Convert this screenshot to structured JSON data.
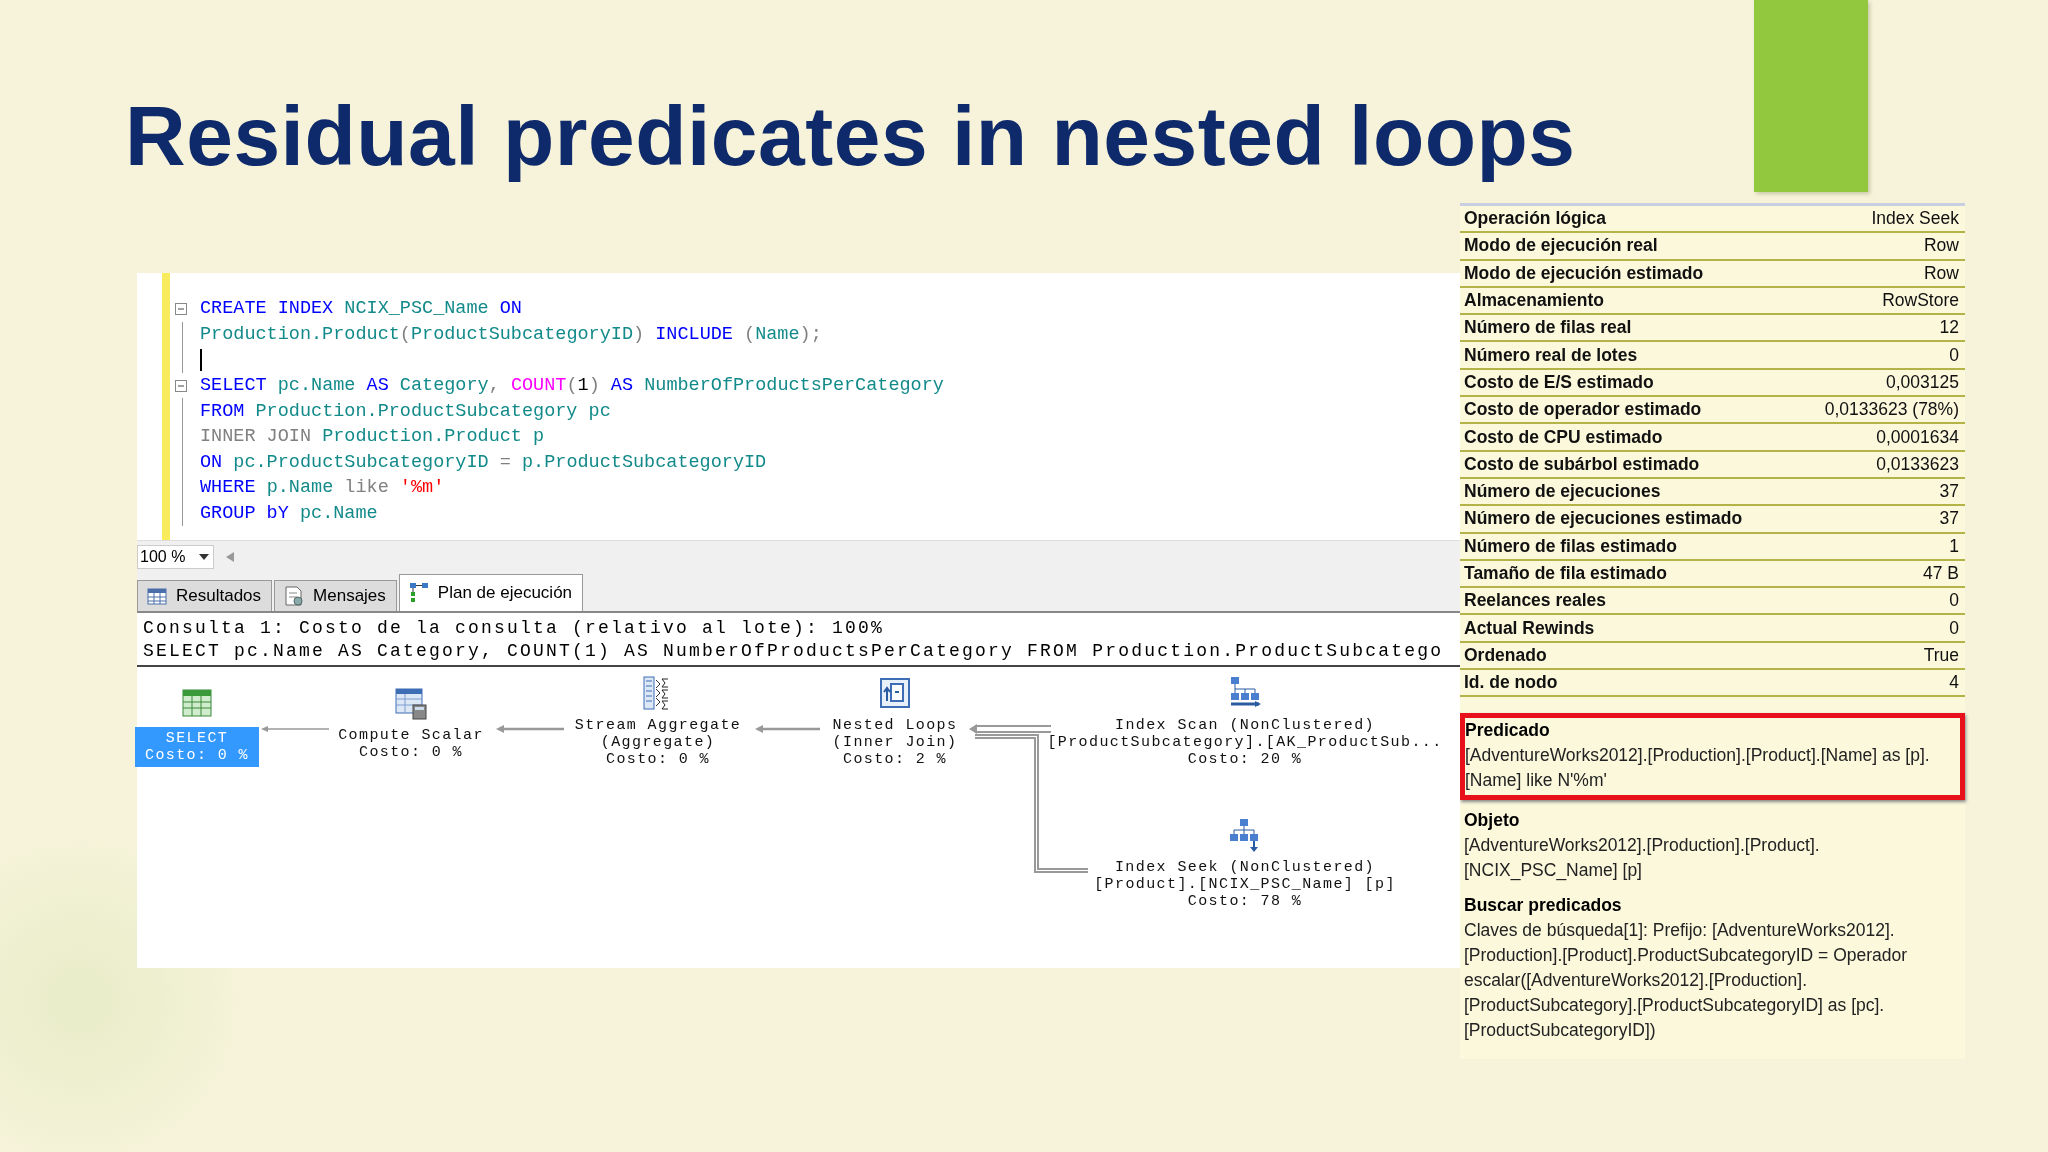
{
  "slide": {
    "title": "Residual predicates in nested loops"
  },
  "editor": {
    "lines": [
      {
        "fold": true,
        "tokens": [
          {
            "text": "CREATE INDEX ",
            "kind": "kw"
          },
          {
            "text": "NCIX_PSC_Name ",
            "kind": "id"
          },
          {
            "text": "ON",
            "kind": "kw"
          }
        ]
      },
      {
        "fold": false,
        "tokens": [
          {
            "text": "Production.Product",
            "kind": "id"
          },
          {
            "text": "(",
            "kind": "op"
          },
          {
            "text": "ProductSubcategoryID",
            "kind": "id"
          },
          {
            "text": ") ",
            "kind": "op"
          },
          {
            "text": "INCLUDE ",
            "kind": "kw"
          },
          {
            "text": "(",
            "kind": "op"
          },
          {
            "text": "Name",
            "kind": "id"
          },
          {
            "text": ");",
            "kind": "op"
          }
        ]
      },
      {
        "fold": false,
        "cursor": true
      },
      {
        "fold": true,
        "tokens": [
          {
            "text": "SELECT ",
            "kind": "kw"
          },
          {
            "text": "pc.Name ",
            "kind": "id"
          },
          {
            "text": "AS ",
            "kind": "kw"
          },
          {
            "text": "Category",
            "kind": "id"
          },
          {
            "text": ", ",
            "kind": "op"
          },
          {
            "text": "COUNT",
            "kind": "fn"
          },
          {
            "text": "(",
            "kind": "op"
          },
          {
            "text": "1",
            "kind": "num"
          },
          {
            "text": ") ",
            "kind": "op"
          },
          {
            "text": "AS ",
            "kind": "kw"
          },
          {
            "text": "NumberOfProductsPerCategory",
            "kind": "id"
          }
        ]
      },
      {
        "fold": false,
        "tokens": [
          {
            "text": "FROM ",
            "kind": "kw"
          },
          {
            "text": "Production.ProductSubcategory pc",
            "kind": "id"
          }
        ]
      },
      {
        "fold": false,
        "tokens": [
          {
            "text": "INNER JOIN ",
            "kind": "op"
          },
          {
            "text": "Production.Product p",
            "kind": "id"
          }
        ]
      },
      {
        "fold": false,
        "tokens": [
          {
            "text": "ON ",
            "kind": "kw"
          },
          {
            "text": "pc.ProductSubcategoryID ",
            "kind": "id"
          },
          {
            "text": "= ",
            "kind": "op"
          },
          {
            "text": "p.ProductSubcategoryID",
            "kind": "id"
          }
        ]
      },
      {
        "fold": false,
        "tokens": [
          {
            "text": "WHERE ",
            "kind": "kw"
          },
          {
            "text": "p.Name ",
            "kind": "id"
          },
          {
            "text": "like ",
            "kind": "op"
          },
          {
            "text": "'%m'",
            "kind": "str"
          }
        ]
      },
      {
        "fold": false,
        "tokens": [
          {
            "text": "GROUP bY ",
            "kind": "kw"
          },
          {
            "text": "pc.Name",
            "kind": "id"
          }
        ]
      }
    ],
    "zoom": "100 %"
  },
  "result_tabs": [
    {
      "label": "Resultados",
      "selected": false,
      "kind": "grid"
    },
    {
      "label": "Mensajes",
      "selected": false,
      "kind": "messages"
    },
    {
      "label": "Plan de ejecución",
      "selected": true,
      "kind": "plan"
    }
  ],
  "plan": {
    "header": [
      "Consulta 1: Costo de la consulta (relativo al lote): 100%",
      "SELECT pc.Name AS Category, COUNT(1) AS NumberOfProductsPerCategory FROM Production.ProductSubcatego"
    ],
    "nodes": [
      {
        "kind": "select",
        "selected": true,
        "lines": [
          "SELECT",
          "Costo: 0 %"
        ]
      },
      {
        "kind": "compute",
        "selected": false,
        "lines": [
          "Compute Scalar",
          "Costo: 0 %"
        ]
      },
      {
        "kind": "aggregate",
        "selected": false,
        "lines": [
          "Stream Aggregate",
          "(Aggregate)",
          "Costo: 0 %"
        ]
      },
      {
        "kind": "loops",
        "selected": false,
        "lines": [
          "Nested Loops",
          "(Inner Join)",
          "Costo: 2 %"
        ]
      },
      {
        "kind": "scan",
        "selected": false,
        "lines": [
          "Index Scan (NonClustered)",
          "[ProductSubcategory].[AK_ProductSub...",
          "Costo: 20 %"
        ]
      },
      {
        "kind": "seek",
        "selected": false,
        "lines": [
          "Index Seek (NonClustered)",
          "[Product].[NCIX_PSC_Name] [p]",
          "Costo: 78 %"
        ]
      }
    ]
  },
  "properties": {
    "rows": [
      {
        "label": "Operación lógica",
        "value": "Index Seek"
      },
      {
        "label": "Modo de ejecución real",
        "value": "Row"
      },
      {
        "label": "Modo de ejecución estimado",
        "value": "Row"
      },
      {
        "label": "Almacenamiento",
        "value": "RowStore"
      },
      {
        "label": "Número de filas real",
        "value": "12"
      },
      {
        "label": "Número real de lotes",
        "value": "0"
      },
      {
        "label": "Costo de E/S estimado",
        "value": "0,003125"
      },
      {
        "label": "Costo de operador estimado",
        "value": "0,0133623 (78%)"
      },
      {
        "label": "Costo de CPU estimado",
        "value": "0,0001634"
      },
      {
        "label": "Costo de subárbol estimado",
        "value": "0,0133623"
      },
      {
        "label": "Número de ejecuciones",
        "value": "37"
      },
      {
        "label": "Número de ejecuciones estimado",
        "value": "37"
      },
      {
        "label": "Número de filas estimado",
        "value": "1"
      },
      {
        "label": "Tamaño de fila estimado",
        "value": "47 B"
      },
      {
        "label": "Reelances reales",
        "value": "0"
      },
      {
        "label": "Actual Rewinds",
        "value": "0"
      },
      {
        "label": "Ordenado",
        "value": "True"
      },
      {
        "label": "Id. de nodo",
        "value": "4"
      }
    ],
    "details": [
      {
        "heading": "Predicado",
        "text": "[AdventureWorks2012].[Production].[Product].[Name] as [p].[Name] like N'%m'",
        "highlighted": true
      },
      {
        "heading": "Objeto",
        "text": "[AdventureWorks2012].[Production].[Product].[NCIX_PSC_Name] [p]",
        "highlighted": false
      },
      {
        "heading": "Buscar predicados",
        "text": "Claves de búsqueda[1]: Prefijo: [AdventureWorks2012].[Production].[Product].ProductSubcategoryID = Operador escalar([AdventureWorks2012].[Production].[ProductSubcategory].[ProductSubcategoryID] as [pc].[ProductSubcategoryID])",
        "highlighted": false
      }
    ]
  }
}
